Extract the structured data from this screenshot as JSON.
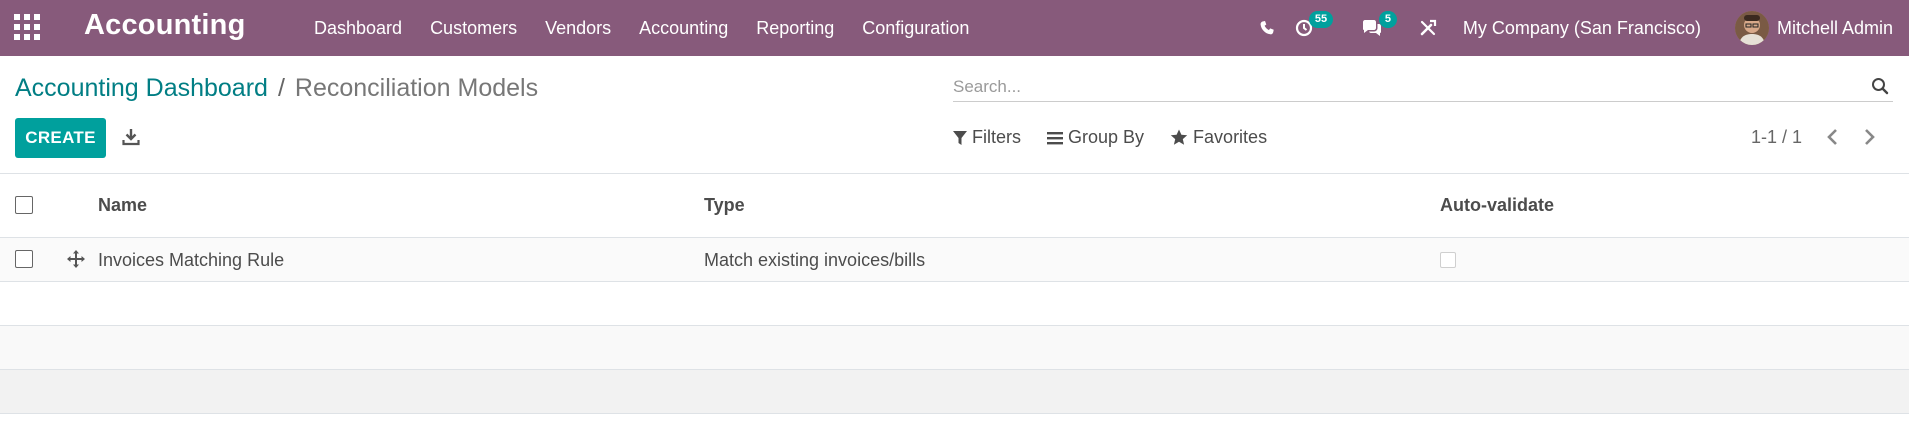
{
  "navbar": {
    "app_title": "Accounting",
    "menu": [
      "Dashboard",
      "Customers",
      "Vendors",
      "Accounting",
      "Reporting",
      "Configuration"
    ],
    "activity_count": "55",
    "messages_count": "5",
    "company": "My Company (San Francisco)",
    "user": "Mitchell Admin",
    "colors": {
      "bar": "#875a7b",
      "badge": "#00a09d"
    }
  },
  "breadcrumb": {
    "parent": "Accounting Dashboard",
    "separator": "/",
    "current": "Reconciliation Models"
  },
  "search": {
    "placeholder": "Search..."
  },
  "toolbar": {
    "create_label": "CREATE",
    "filters_label": "Filters",
    "group_by_label": "Group By",
    "favorites_label": "Favorites",
    "pager": "1-1 / 1"
  },
  "table": {
    "columns": [
      "Name",
      "Type",
      "Auto-validate"
    ],
    "rows": [
      {
        "name": "Invoices Matching Rule",
        "type": "Match existing invoices/bills",
        "auto_validate": false
      }
    ]
  },
  "icons": {
    "apps": "grid-icon",
    "phone": "phone-icon",
    "activity": "clock-icon",
    "messages": "chat-icon",
    "debug": "tools-icon",
    "download": "download-icon",
    "search": "search-icon",
    "filter": "funnel-icon",
    "group_by": "bars-icon",
    "favorites": "star-icon",
    "prev": "chevron-left-icon",
    "next": "chevron-right-icon",
    "handle": "arrows-move-icon"
  }
}
